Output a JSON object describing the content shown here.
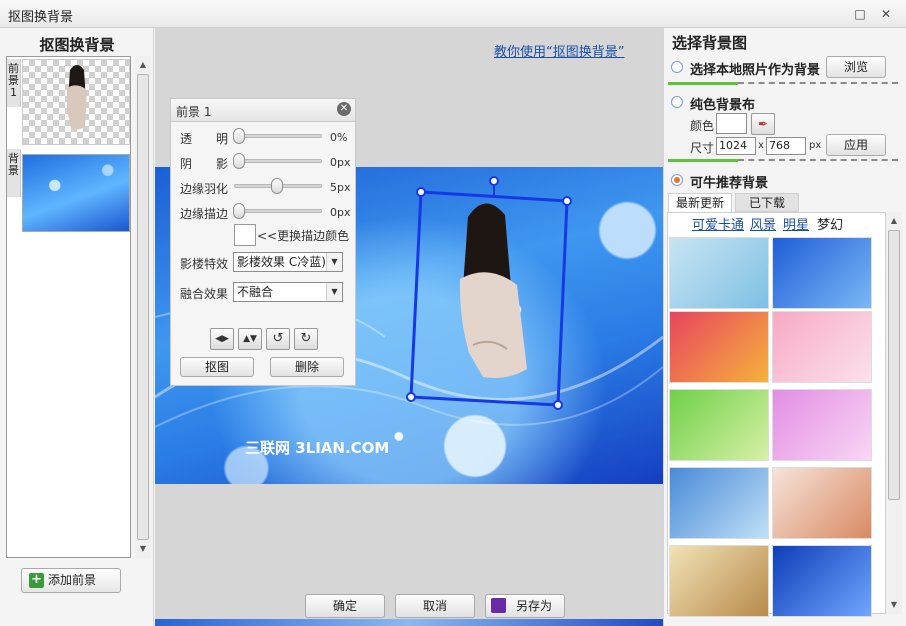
{
  "window": {
    "title": "抠图换背景",
    "maximize_icon": "□",
    "close_icon": "✕"
  },
  "left": {
    "title": "抠图换背景",
    "layers": [
      {
        "tab": "前景1"
      },
      {
        "tab": "背景"
      }
    ],
    "add_button": "添加前景",
    "add_icon": "+"
  },
  "center": {
    "tutorial_link": "教你使用“抠图换背景”",
    "watermark": "三联网 3LIAN.COM"
  },
  "fg_panel": {
    "title": "前景 1",
    "close_icon": "✕",
    "sliders": [
      {
        "label": "透　　明",
        "value": "0%",
        "level": 0
      },
      {
        "label": "阴　　影",
        "value": "0px",
        "level": 0
      },
      {
        "label": "边缘羽化",
        "value": "5px",
        "level": 0.5
      },
      {
        "label": "边缘描边",
        "value": "0px",
        "level": 0
      }
    ],
    "change_border_color": "<<更换描边颜色",
    "effect_label": "影楼特效",
    "effect_value": "影楼效果 C冷蓝)",
    "blend_label": "融合效果",
    "blend_value": "不融合",
    "tools": [
      "◀▶",
      "▲▼",
      "↺",
      "↻"
    ],
    "cutout_button": "抠图",
    "delete_button": "删除"
  },
  "actions": {
    "ok": "确定",
    "cancel": "取消",
    "save_as": "另存为"
  },
  "right": {
    "title": "选择背景图",
    "option_local": "选择本地照片作为背景",
    "browse_button": "浏览",
    "option_solid": "纯色背景布",
    "color_label": "颜色",
    "size_label": "尺寸",
    "width": "1024",
    "times": "x",
    "height": "768",
    "unit": "px",
    "apply_button": "应用",
    "option_recommend": "可牛推荐背景",
    "tabs": [
      "最新更新",
      "已下载"
    ],
    "categories": [
      "可爱卡通",
      "风景",
      "明星",
      "梦幻"
    ],
    "thumb_colors": [
      [
        "#c7e4f2",
        "#7fc0e4"
      ],
      [
        "#1f5ed8",
        "#7ab8f5"
      ],
      [
        "#e8455f",
        "#f5b13c"
      ],
      [
        "#f7a9c6",
        "#fbe1ec"
      ],
      [
        "#6fd14a",
        "#d8f0a6"
      ],
      [
        "#e28ee3",
        "#f9d6f5"
      ],
      [
        "#4a8ad8",
        "#bfe0f7"
      ],
      [
        "#f6e3da",
        "#d98a62"
      ],
      [
        "#f1e2b5",
        "#b88a4c"
      ],
      [
        "#0f3db8",
        "#6fa6ff"
      ]
    ]
  }
}
